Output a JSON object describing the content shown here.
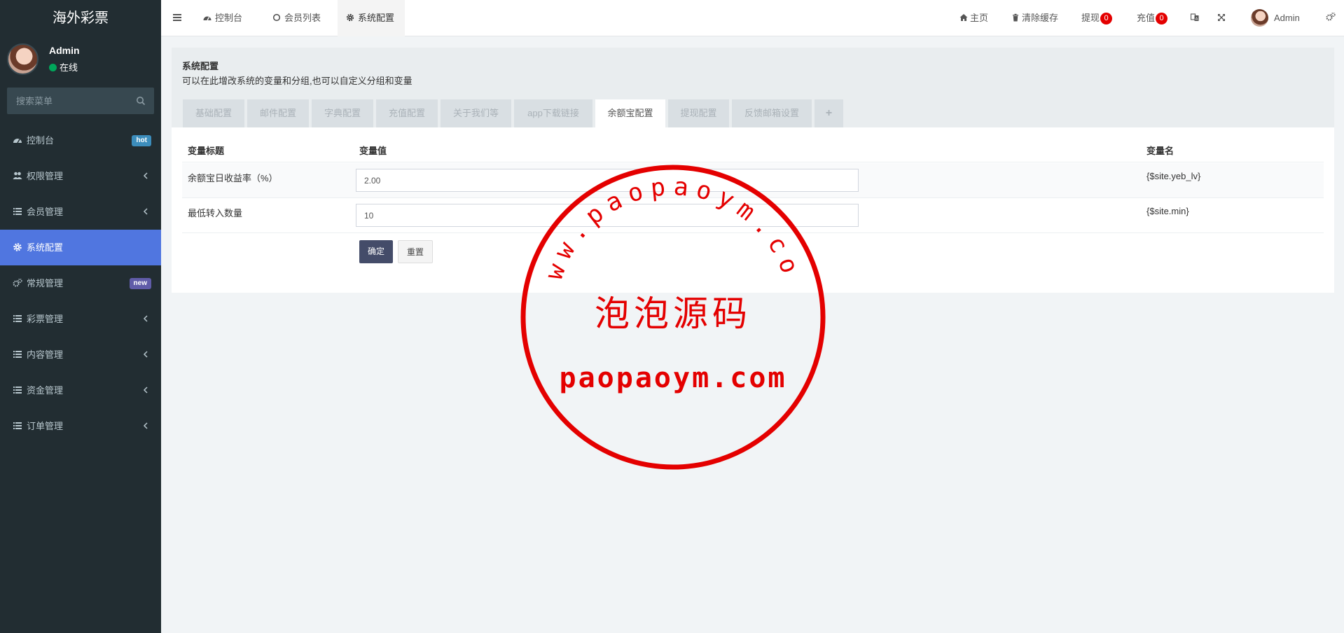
{
  "app": {
    "title": "海外彩票"
  },
  "user": {
    "name": "Admin",
    "status": "在线"
  },
  "sidebar": {
    "search_placeholder": "搜索菜单",
    "items": [
      {
        "label": "控制台",
        "icon": "dashboard-icon",
        "badge": "hot"
      },
      {
        "label": "权限管理",
        "icon": "users-icon"
      },
      {
        "label": "会员管理",
        "icon": "list-icon"
      },
      {
        "label": "系统配置",
        "icon": "gear-icon",
        "active": true
      },
      {
        "label": "常规管理",
        "icon": "gears-icon",
        "badge": "new"
      },
      {
        "label": "彩票管理",
        "icon": "list-icon"
      },
      {
        "label": "内容管理",
        "icon": "list-icon"
      },
      {
        "label": "资金管理",
        "icon": "list-icon"
      },
      {
        "label": "订单管理",
        "icon": "list-icon"
      }
    ]
  },
  "topbar": {
    "tabs": [
      {
        "label": "控制台",
        "icon": "dashboard-icon"
      },
      {
        "label": "会员列表",
        "icon": "circle-icon"
      },
      {
        "label": "系统配置",
        "icon": "gear-icon",
        "active": true
      }
    ],
    "home": "主页",
    "clear_cache": "清除缓存",
    "withdraw": {
      "label": "提现",
      "count": "0"
    },
    "recharge": {
      "label": "充值",
      "count": "0"
    },
    "admin": "Admin"
  },
  "panel": {
    "title": "系统配置",
    "desc": "可以在此增改系统的变量和分组,也可以自定义分组和变量",
    "tabs": [
      "基础配置",
      "邮件配置",
      "字典配置",
      "充值配置",
      "关于我们等",
      "app下载链接",
      "余额宝配置",
      "提现配置",
      "反馈邮箱设置",
      "+"
    ],
    "active_tab": "余额宝配置"
  },
  "table": {
    "headers": {
      "title": "变量标题",
      "value": "变量值",
      "name": "变量名"
    },
    "rows": [
      {
        "title": "余额宝日收益率（%）",
        "value": "2.00",
        "name": "{$site.yeb_lv}"
      },
      {
        "title": "最低转入数量",
        "value": "10",
        "name": "{$site.min}"
      }
    ]
  },
  "buttons": {
    "confirm": "确定",
    "reset": "重置"
  },
  "watermark": {
    "arc_text": "www.paopaoym.com",
    "center_text": "泡泡源码",
    "bottom_text": "paopaoym.com",
    "color": "#e40000"
  },
  "colors": {
    "sidebar": "#222d32",
    "accent": "#5076e0",
    "badge_red": "#e40000"
  }
}
